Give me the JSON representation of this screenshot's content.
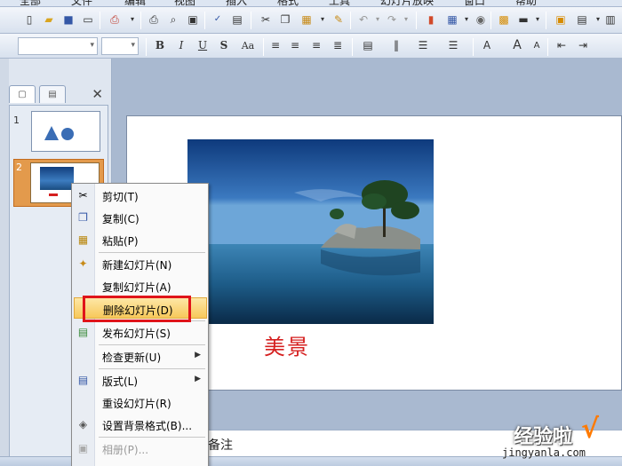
{
  "menu": {
    "items": [
      "工具",
      "幻灯片放映",
      "窗口",
      "帮助"
    ]
  },
  "slides": [
    {
      "number": "1"
    },
    {
      "number": "2"
    }
  ],
  "slide": {
    "caption": "美景"
  },
  "notes": {
    "label": "备注"
  },
  "context_menu": {
    "items": [
      {
        "icon": "scissors-icon",
        "label": "剪切(T)"
      },
      {
        "icon": "copy-icon",
        "label": "复制(C)"
      },
      {
        "icon": "paste-icon",
        "label": "粘贴(P)"
      },
      {
        "icon": "new-slide-icon",
        "label": "新建幻灯片(N)"
      },
      {
        "icon": "none",
        "label": "复制幻灯片(A)"
      },
      {
        "icon": "none",
        "label": "删除幻灯片(D)"
      },
      {
        "icon": "publish-slides-icon",
        "label": "发布幻灯片(S)"
      },
      {
        "icon": "none",
        "label": "检查更新(U)"
      },
      {
        "icon": "layout-icon",
        "label": "版式(L)"
      },
      {
        "icon": "none",
        "label": "重设幻灯片(R)"
      },
      {
        "icon": "format-background-icon",
        "label": "设置背景格式(B)..."
      },
      {
        "icon": "photo-album-icon",
        "label": "相册(P)..."
      }
    ]
  },
  "watermark": {
    "text": "经验啦",
    "check": "√",
    "url": "jingyanla.com"
  },
  "colors": {
    "highlight": "#f7c85a",
    "annotation_box": "#e0141a",
    "caption": "#d51f1f"
  }
}
